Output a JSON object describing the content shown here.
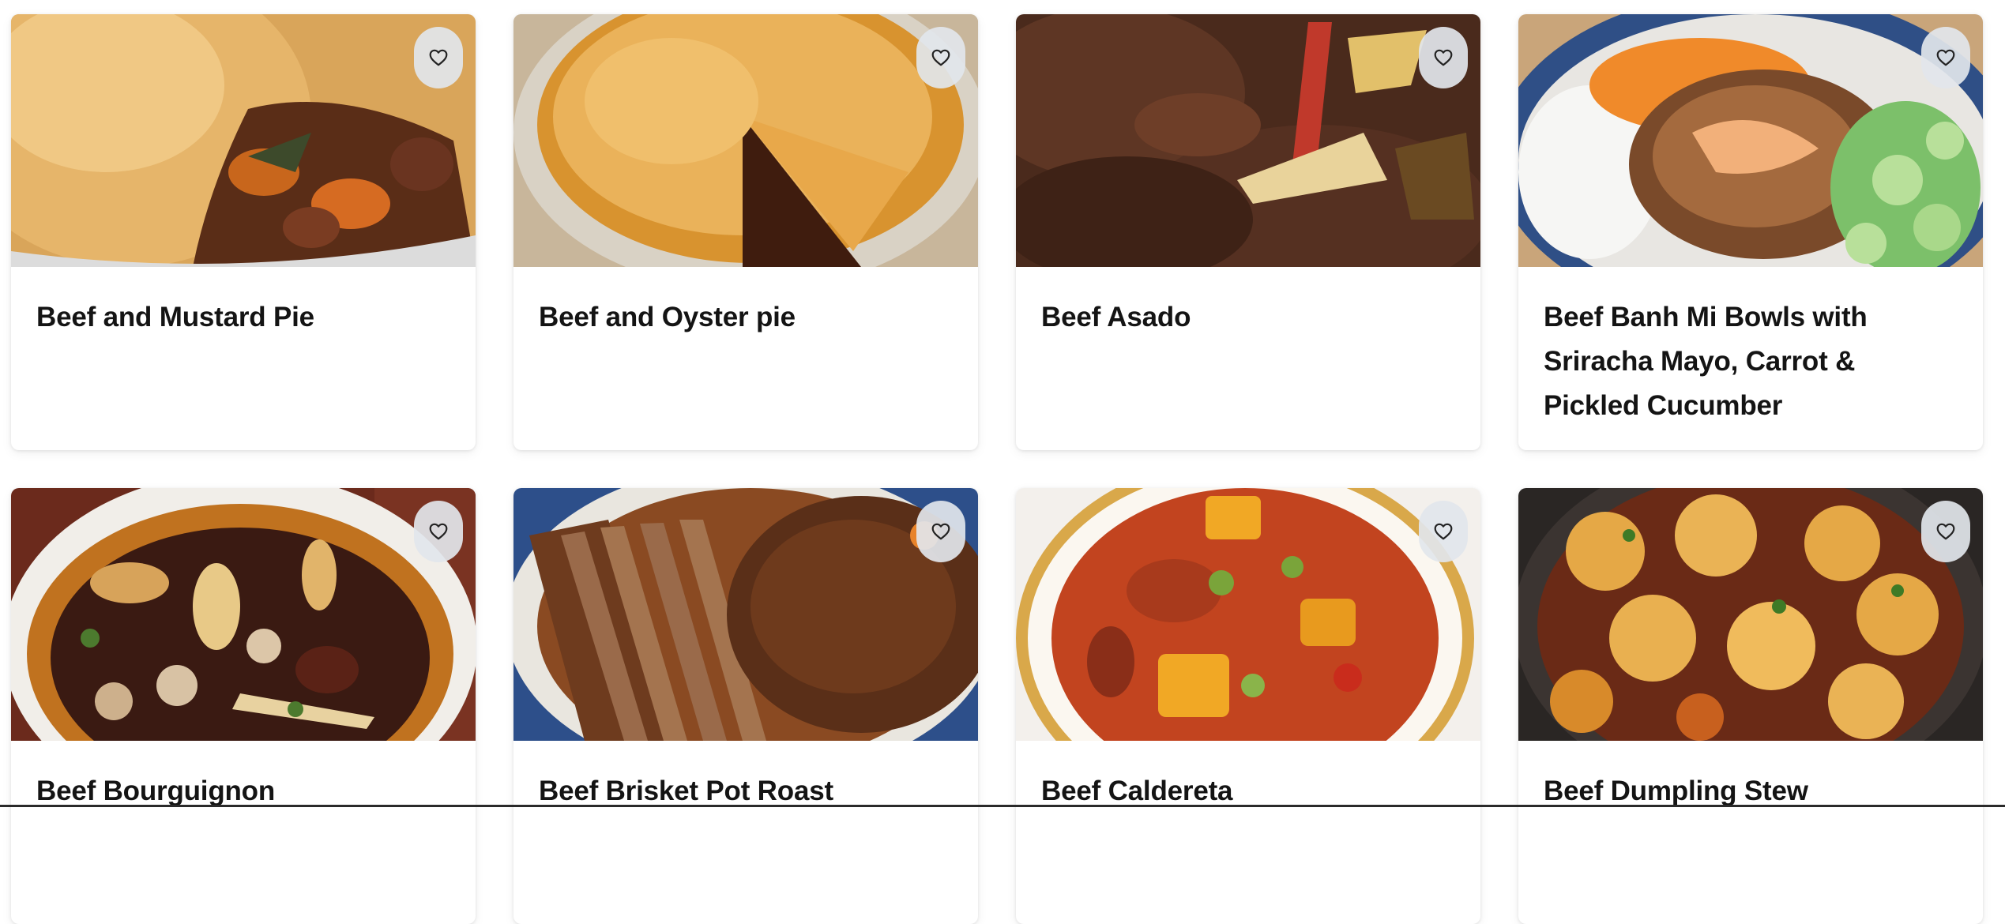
{
  "recipes": [
    {
      "name": "Beef and Mustard Pie"
    },
    {
      "name": "Beef and Oyster pie"
    },
    {
      "name": "Beef Asado"
    },
    {
      "name": "Beef Banh Mi Bowls with Sriracha Mayo, Carrot & Pickled Cucumber"
    },
    {
      "name": "Beef Bourguignon"
    },
    {
      "name": "Beef Brisket Pot Roast"
    },
    {
      "name": "Beef Caldereta"
    },
    {
      "name": "Beef Dumpling Stew"
    }
  ],
  "icons": {
    "favorite": "heart-outline-icon"
  },
  "colors": {
    "card_background": "#ffffff",
    "favorite_button_background": "#e2e6ec",
    "title_text": "#141414"
  }
}
